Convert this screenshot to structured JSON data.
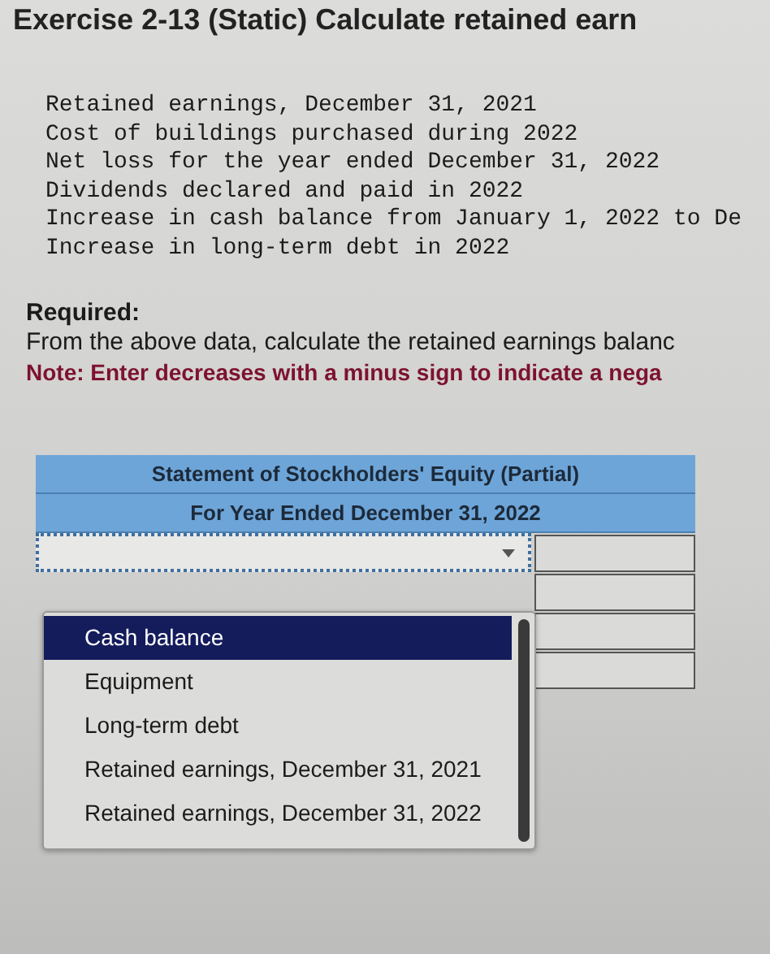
{
  "title": "Exercise 2-13 (Static) Calculate retained earn",
  "data_lines": [
    "Retained earnings, December 31, 2021",
    "Cost of buildings purchased during 2022",
    "Net loss for the year ended December 31, 2022",
    "Dividends declared and paid in 2022",
    "Increase in cash balance from January 1, 2022 to De",
    "Increase in long-term debt in 2022"
  ],
  "required": {
    "heading": "Required:",
    "text": "From the above data, calculate the retained earnings balanc",
    "note": "Note: Enter decreases with a minus sign to indicate a nega"
  },
  "table": {
    "header": [
      "Statement of Stockholders' Equity (Partial)",
      "For Year Ended December 31, 2022"
    ]
  },
  "dropdown": {
    "options": [
      {
        "label": "Cash balance",
        "selected": true
      },
      {
        "label": "Equipment",
        "selected": false
      },
      {
        "label": "Long-term debt",
        "selected": false
      },
      {
        "label": "Retained earnings, December 31, 2021",
        "selected": false
      },
      {
        "label": "Retained earnings, December 31, 2022",
        "selected": false
      }
    ]
  }
}
